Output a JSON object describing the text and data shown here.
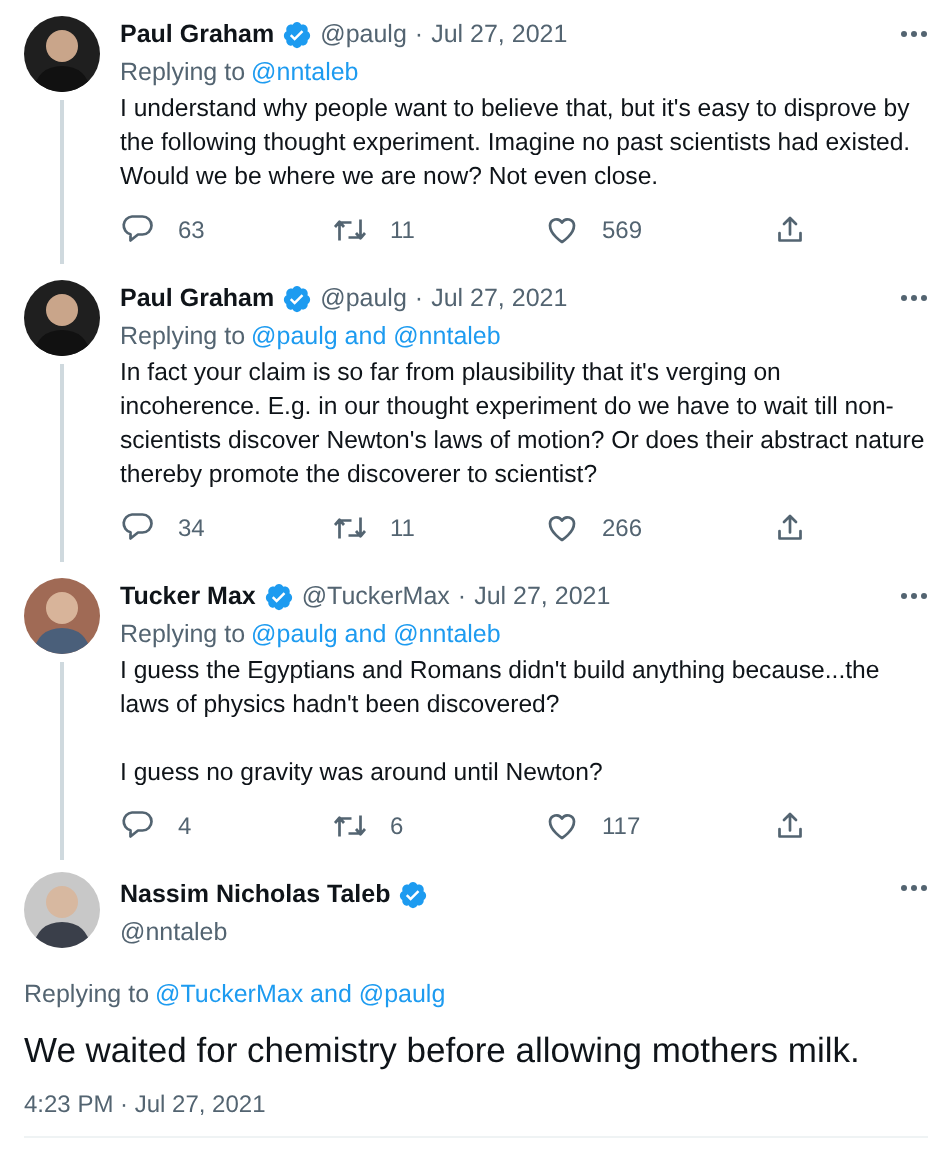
{
  "tweets": [
    {
      "kind": "reply",
      "name": "Paul Graham",
      "verified": true,
      "handle": "@paulg",
      "separator": "·",
      "date": "Jul 27, 2021",
      "replying_prefix": "Replying to",
      "replying_to": "@nntaleb",
      "body": [
        "I understand why people want to believe that, but it's easy to disprove by the following thought experiment. Imagine no past scientists had existed. Would we be where we are now? Not even close."
      ],
      "replies": "63",
      "retweets": "11",
      "likes": "569"
    },
    {
      "kind": "reply",
      "name": "Paul Graham",
      "verified": true,
      "handle": "@paulg",
      "separator": "·",
      "date": "Jul 27, 2021",
      "replying_prefix": "Replying to",
      "replying_to": "@paulg and @nntaleb",
      "body": [
        "In fact your claim is so far from plausibility that it's verging on incoherence. E.g. in our thought experiment do we have to wait till non-scientists discover Newton's laws of motion? Or does their abstract nature thereby promote the discoverer to scientist?"
      ],
      "replies": "34",
      "retweets": "11",
      "likes": "266"
    },
    {
      "kind": "reply",
      "name": "Tucker Max",
      "verified": true,
      "handle": "@TuckerMax",
      "separator": "·",
      "date": "Jul 27, 2021",
      "replying_prefix": "Replying to",
      "replying_to": "@paulg and @nntaleb",
      "body": [
        "I guess the Egyptians and Romans didn't build anything because...the laws of physics hadn't been discovered?",
        "I guess no gravity was around until Newton?"
      ],
      "replies": "4",
      "retweets": "6",
      "likes": "117"
    },
    {
      "kind": "main",
      "name": "Nassim Nicholas Taleb",
      "verified": true,
      "handle": "@nntaleb",
      "replying_prefix": "Replying to",
      "replying_to": "@TuckerMax and @paulg",
      "body": [
        "We waited for chemistry before allowing mothers milk."
      ],
      "timestamp": "4:23 PM · Jul 27, 2021"
    }
  ]
}
